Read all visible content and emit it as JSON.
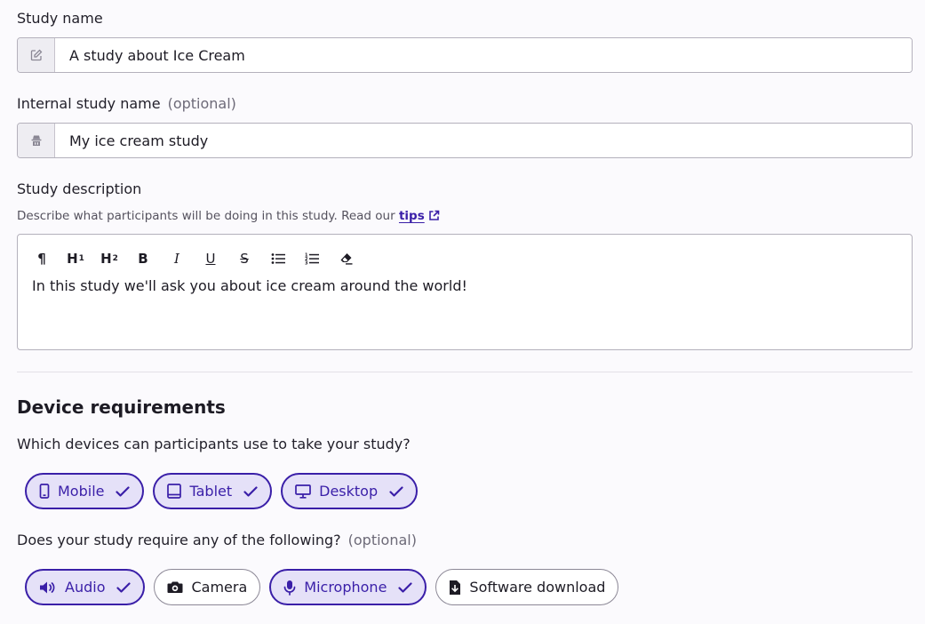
{
  "study_name": {
    "label": "Study name",
    "value": "A study about Ice Cream",
    "icon": "pencil-edit-icon"
  },
  "internal_name": {
    "label": "Internal study name",
    "optional": "(optional)",
    "value": "My ice cream study",
    "icon": "incognito-spy-icon"
  },
  "description": {
    "label": "Study description",
    "help_text": "Describe what participants will be doing in this study. Read our",
    "help_link": "tips",
    "toolbar": [
      {
        "glyph": "¶",
        "sub": "",
        "name": "paragraph-icon"
      },
      {
        "glyph": "H",
        "sub": "1",
        "name": "heading-1-icon"
      },
      {
        "glyph": "H",
        "sub": "2",
        "name": "heading-2-icon"
      },
      {
        "glyph": "B",
        "sub": "",
        "name": "bold-icon"
      },
      {
        "glyph": "I",
        "sub": "",
        "name": "italic-icon"
      },
      {
        "glyph": "U",
        "sub": "",
        "name": "underline-icon"
      },
      {
        "glyph": "S",
        "sub": "",
        "name": "strikethrough-icon"
      },
      {
        "glyph": "",
        "sub": "",
        "name": "bullet-list-icon"
      },
      {
        "glyph": "",
        "sub": "",
        "name": "numbered-list-icon"
      },
      {
        "glyph": "",
        "sub": "",
        "name": "clear-format-icon"
      }
    ],
    "value": "In this study we'll ask you about ice cream around the world!"
  },
  "device_requirements": {
    "title": "Device requirements",
    "question": "Which devices can participants use to take your study?",
    "devices": [
      {
        "label": "Mobile",
        "selected": true,
        "icon": "mobile-phone-icon"
      },
      {
        "label": "Tablet",
        "selected": true,
        "icon": "tablet-icon"
      },
      {
        "label": "Desktop",
        "selected": true,
        "icon": "desktop-monitor-icon"
      }
    ],
    "requirements_question": "Does your study require any of the following?",
    "requirements_optional": "(optional)",
    "requirements": [
      {
        "label": "Audio",
        "selected": true,
        "icon": "speaker-icon"
      },
      {
        "label": "Camera",
        "selected": false,
        "icon": "camera-icon"
      },
      {
        "label": "Microphone",
        "selected": true,
        "icon": "microphone-icon"
      },
      {
        "label": "Software download",
        "selected": false,
        "icon": "download-file-icon"
      }
    ]
  },
  "colors": {
    "accent": "#3a1fa8",
    "chip_selected_bg": "#e5e1f8",
    "page_bg": "#fbfafd"
  }
}
